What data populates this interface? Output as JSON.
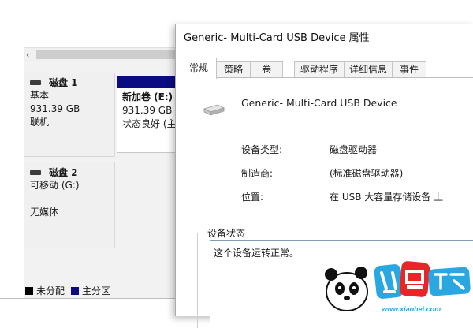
{
  "disk_mgmt": {
    "scroll_arrow": "‹",
    "disks": [
      {
        "name": "磁盘 1",
        "type": "基本",
        "size": "931.39 GB",
        "state": "联机"
      },
      {
        "name": "磁盘 2",
        "type": "可移动 (G:)",
        "size": "",
        "state": "无媒体"
      }
    ],
    "volume": {
      "name": "新加卷  (E:)",
      "size": "931.39 GB N",
      "status": "状态良好 (主"
    },
    "legend": [
      {
        "label": "未分配",
        "color": "#000000"
      },
      {
        "label": "主分区",
        "color": "#0b0b82"
      }
    ]
  },
  "dialog": {
    "title": "Generic- Multi-Card USB Device 属性",
    "tabs": [
      "常规",
      "策略",
      "卷",
      "驱动程序",
      "详细信息",
      "事件"
    ],
    "active_tab": "常规",
    "device_name": "Generic- Multi-Card USB Device",
    "properties": [
      {
        "label": "设备类型:",
        "value": "磁盘驱动器"
      },
      {
        "label": "制造商:",
        "value": "(标准磁盘驱动器)"
      },
      {
        "label": "位置:",
        "value": "在 USB 大容量存储设备 上"
      }
    ],
    "status_group_title": "设备状态",
    "status_text": "这个设备运转正常。"
  },
  "watermark": {
    "brand": "小黑游戏",
    "url": "www.xiaohei.com"
  }
}
